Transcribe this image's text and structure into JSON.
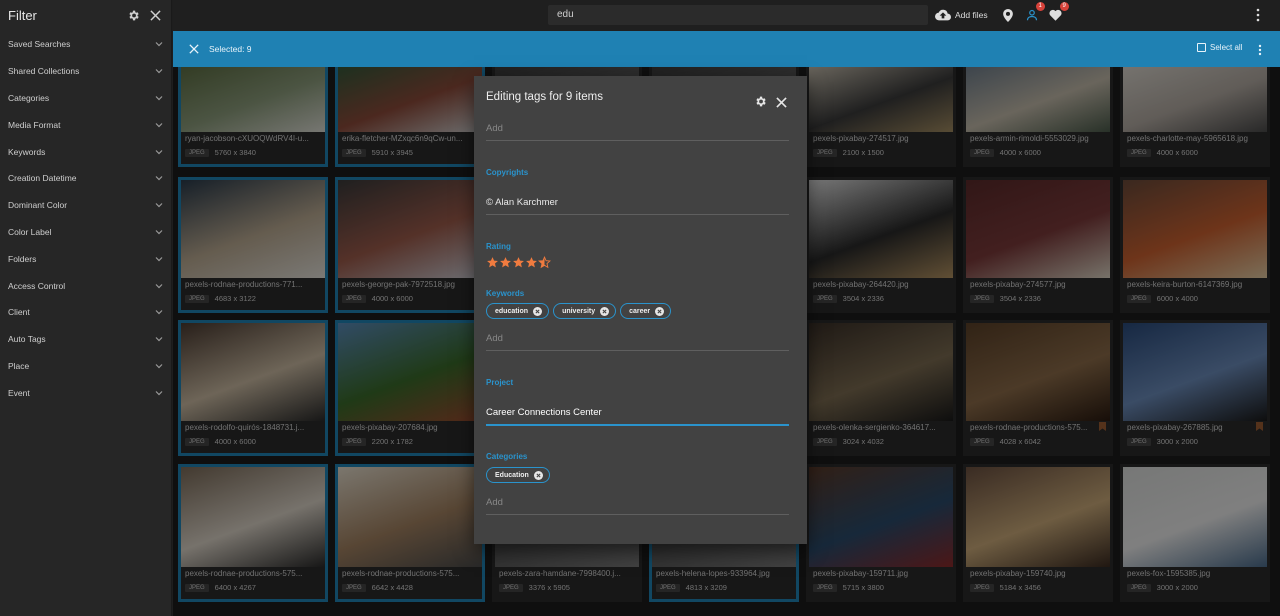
{
  "sidebar": {
    "title": "Filter",
    "items": [
      {
        "label": "Saved Searches"
      },
      {
        "label": "Shared Collections"
      },
      {
        "label": "Categories"
      },
      {
        "label": "Media Format"
      },
      {
        "label": "Keywords"
      },
      {
        "label": "Creation Datetime"
      },
      {
        "label": "Dominant Color"
      },
      {
        "label": "Color Label"
      },
      {
        "label": "Folders"
      },
      {
        "label": "Access Control"
      },
      {
        "label": "Client"
      },
      {
        "label": "Auto Tags"
      },
      {
        "label": "Place"
      },
      {
        "label": "Event"
      }
    ]
  },
  "topbar": {
    "search_value": "edu",
    "add_files_label": "Add files",
    "badge_people": "1",
    "badge_likes": "9"
  },
  "selection": {
    "text": "Selected: 9",
    "select_all_label": "Select all"
  },
  "modal": {
    "title": "Editing tags for 9 items",
    "add_placeholder": "Add",
    "copyrights_label": "Copyrights",
    "copyrights_value": "© Alan Karchmer",
    "rating_label": "Rating",
    "rating_value": 4.5,
    "keywords_label": "Keywords",
    "keywords": [
      "education",
      "university",
      "career"
    ],
    "keywords_add": "Add",
    "project_label": "Project",
    "project_value": "Career Connections Center",
    "categories_label": "Categories",
    "categories": [
      "Education"
    ],
    "categories_add": "Add"
  },
  "cards": [
    {
      "name": "ryan-jacobson-cXUOQWdRV4I-u...",
      "type": "JPEG",
      "dims": "5760 x 3840"
    },
    {
      "name": "erika-fletcher-MZxqc6n9qCw-un...",
      "type": "JPEG",
      "dims": "5910 x 3945"
    },
    {
      "name": "",
      "type": "",
      "dims": ""
    },
    {
      "name": "",
      "type": "",
      "dims": ""
    },
    {
      "name": "pexels-pixabay-274517.jpg",
      "type": "JPEG",
      "dims": "2100 x 1500"
    },
    {
      "name": "pexels-armin-rimoldi-5553029.jpg",
      "type": "JPEG",
      "dims": "4000 x 6000"
    },
    {
      "name": "pexels-charlotte-may-5965618.jpg",
      "type": "JPEG",
      "dims": "4000 x 6000"
    },
    {
      "name": "pexels-rodnae-productions-771...",
      "type": "JPEG",
      "dims": "4683 x 3122"
    },
    {
      "name": "pexels-george-pak-7972518.jpg",
      "type": "JPEG",
      "dims": "4000 x 6000"
    },
    {
      "name": "",
      "type": "",
      "dims": ""
    },
    {
      "name": "",
      "type": "",
      "dims": ""
    },
    {
      "name": "pexels-pixabay-264420.jpg",
      "type": "JPEG",
      "dims": "3504 x 2336"
    },
    {
      "name": "pexels-pixabay-274577.jpg",
      "type": "JPEG",
      "dims": "3504 x 2336"
    },
    {
      "name": "pexels-keira-burton-6147369.jpg",
      "type": "JPEG",
      "dims": "6000 x 4000"
    },
    {
      "name": "pexels-rodolfo-quirós-1848731.j...",
      "type": "JPEG",
      "dims": "4000 x 6000"
    },
    {
      "name": "pexels-pixabay-207684.jpg",
      "type": "JPEG",
      "dims": "2200 x 1782"
    },
    {
      "name": "",
      "type": "",
      "dims": ""
    },
    {
      "name": "",
      "type": "",
      "dims": ""
    },
    {
      "name": "pexels-olenka-sergienko-364617...",
      "type": "JPEG",
      "dims": "3024 x 4032"
    },
    {
      "name": "pexels-rodnae-productions-575...",
      "type": "JPEG",
      "dims": "4028 x 6042"
    },
    {
      "name": "pexels-pixabay-267885.jpg",
      "type": "JPEG",
      "dims": "3000 x 2000"
    },
    {
      "name": "pexels-rodnae-productions-575...",
      "type": "JPEG",
      "dims": "6400 x 4267"
    },
    {
      "name": "pexels-rodnae-productions-575...",
      "type": "JPEG",
      "dims": "6642 x 4428"
    },
    {
      "name": "pexels-zara-hamdane-7998400.j...",
      "type": "JPEG",
      "dims": "3376 x 5905"
    },
    {
      "name": "pexels-helena-lopes-933964.jpg",
      "type": "JPEG",
      "dims": "4813 x 3209"
    },
    {
      "name": "pexels-pixabay-159711.jpg",
      "type": "JPEG",
      "dims": "5715 x 3800"
    },
    {
      "name": "pexels-pixabay-159740.jpg",
      "type": "JPEG",
      "dims": "5184 x 3456"
    },
    {
      "name": "pexels-fox-1595385.jpg",
      "type": "JPEG",
      "dims": "3000 x 2000"
    }
  ],
  "colors": {
    "accent": "#1f81b3",
    "label_blue": "#2a93cc",
    "star": "#f07b3f",
    "bookmark": "#9a5c32",
    "badge": "#d7423a"
  }
}
